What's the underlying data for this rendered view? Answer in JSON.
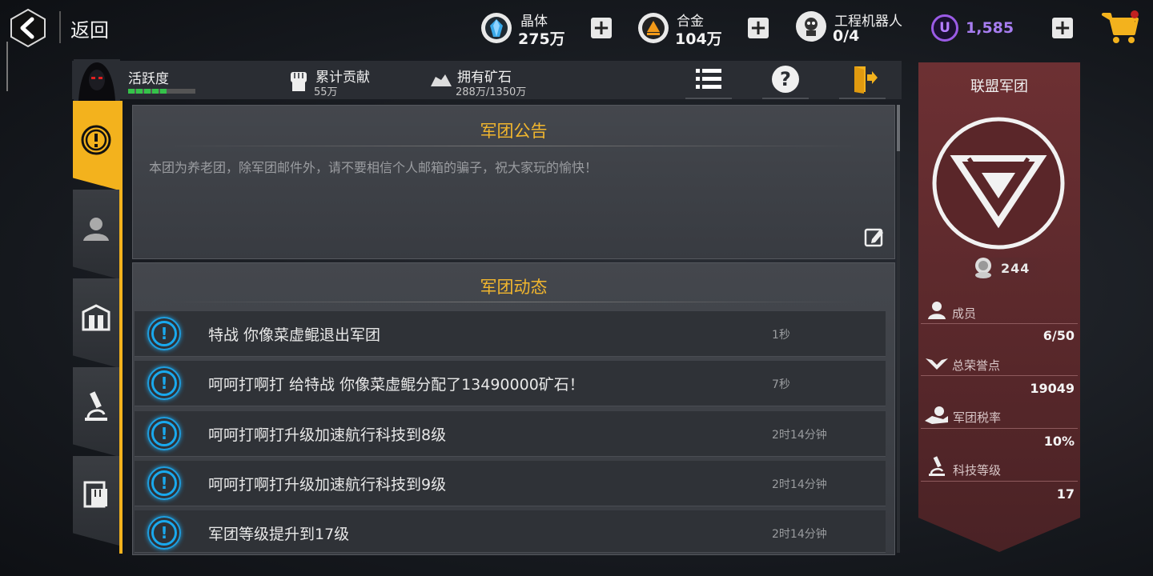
{
  "topbar": {
    "back_label": "返回",
    "resources": [
      {
        "name": "晶体",
        "value": "275万",
        "icon": "crystal-icon",
        "color": "#39a8e8"
      },
      {
        "name": "合金",
        "value": "104万",
        "icon": "alloy-icon",
        "color": "#f39a18"
      },
      {
        "name": "工程机器人",
        "value": "0/4",
        "icon": "robot-icon",
        "color": "#333333"
      }
    ],
    "premium": {
      "value": "1,585",
      "icon": "u-coin-icon",
      "color": "#9b5be6"
    },
    "shop_icon": "cart-icon"
  },
  "statbar": {
    "activity_label": "活跃度",
    "activity_level": 0.6,
    "contribution_label": "累计贡献",
    "contribution_value": "55万",
    "ore_label": "拥有矿石",
    "ore_value": "288万/1350万"
  },
  "announcement": {
    "title": "军团公告",
    "body": "本团为养老团，除军团邮件外，请不要相信个人邮箱的骗子，祝大家玩的愉快！"
  },
  "feed": {
    "title": "军团动态",
    "items": [
      {
        "text": "特战 你像菜虚鲲退出军团",
        "time": "1秒"
      },
      {
        "text": "呵呵打啊打 给特战 你像菜虚鲲分配了13490000矿石！",
        "time": "7秒"
      },
      {
        "text": "呵呵打啊打升级加速航行科技到8级",
        "time": "2时14分钟"
      },
      {
        "text": "呵呵打啊打升级加速航行科技到9级",
        "time": "2时14分钟"
      },
      {
        "text": "军团等级提升到17级",
        "time": "2时14分钟"
      }
    ]
  },
  "alliance": {
    "name": "联盟军团",
    "emblem_count": "244",
    "stats": [
      {
        "label": "成员",
        "value": "6/50",
        "icon": "member-icon"
      },
      {
        "label": "总荣誉点",
        "value": "19049",
        "icon": "wings-icon"
      },
      {
        "label": "军团税率",
        "value": "10%",
        "icon": "tax-hand-icon"
      },
      {
        "label": "科技等级",
        "value": "17",
        "icon": "microscope-icon"
      }
    ]
  },
  "colors": {
    "accent": "#f3b21d",
    "title": "#f1b62e",
    "info_blue": "#19a9ee",
    "alliance_red": "#6d3033"
  }
}
